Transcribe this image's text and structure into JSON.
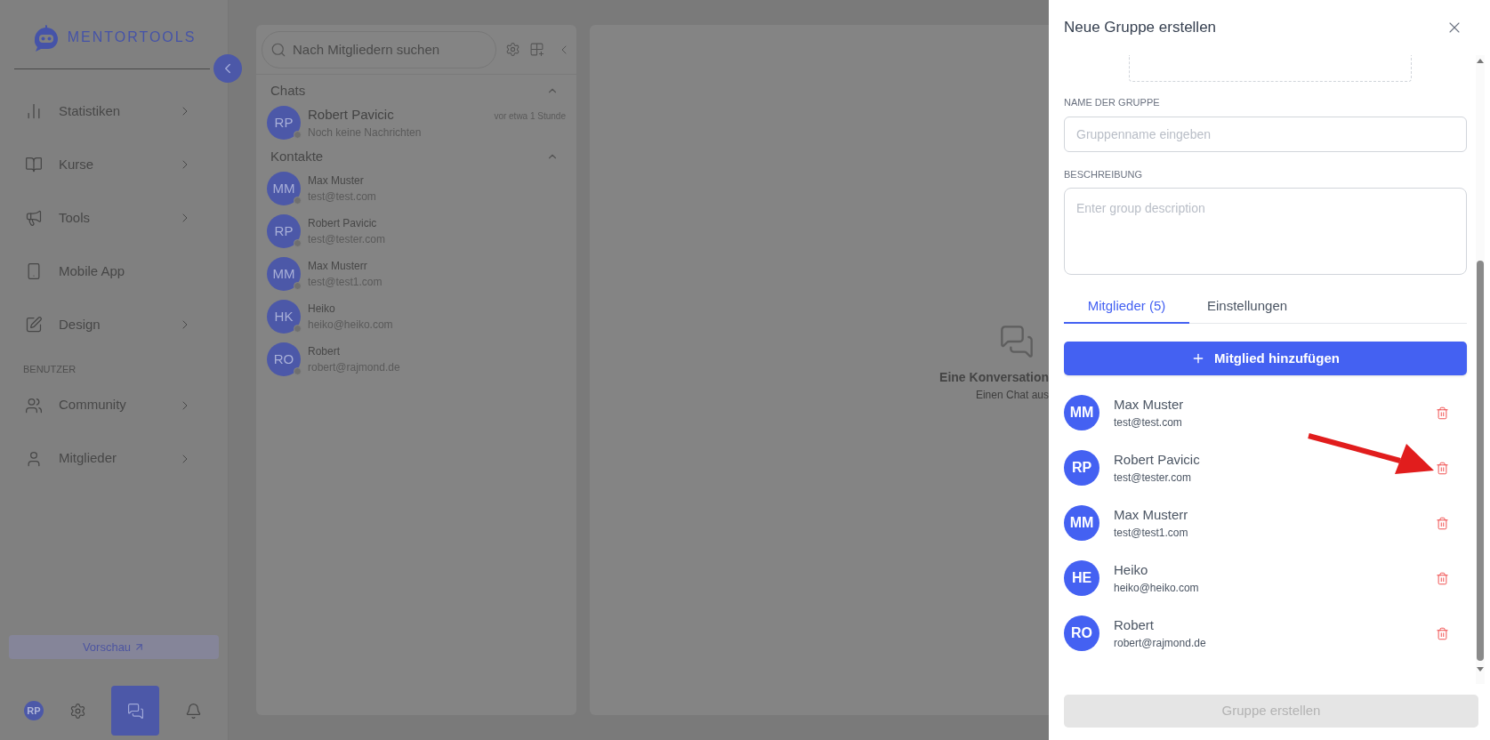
{
  "sidebar": {
    "logo_text": "MENTORTOOLS",
    "nav_items": [
      {
        "kind": "stats",
        "label": "Statistiken",
        "has_submenu": true
      },
      {
        "kind": "book",
        "label": "Kurse",
        "has_submenu": true
      },
      {
        "kind": "megaphone",
        "label": "Tools",
        "has_submenu": true
      },
      {
        "kind": "phone",
        "label": "Mobile App",
        "has_submenu": false
      },
      {
        "kind": "pen",
        "label": "Design",
        "has_submenu": true
      }
    ],
    "section_label": "BENUTZER",
    "user_items": [
      {
        "kind": "group",
        "label": "Community",
        "has_submenu": true
      },
      {
        "kind": "person",
        "label": "Mitglieder",
        "has_submenu": true
      }
    ],
    "preview_button": "Vorschau",
    "bottom_bar": [
      {
        "kind": "avatar",
        "initials": "RP",
        "selected": false
      },
      {
        "kind": "settings",
        "selected": false
      },
      {
        "kind": "chat",
        "selected": true
      },
      {
        "kind": "bell",
        "selected": false
      }
    ]
  },
  "chat_panel": {
    "search": {
      "placeholder": "Nach Mitgliedern suchen"
    },
    "chats_header": "Chats",
    "chats": [
      {
        "initials": "RP",
        "name": "Robert Pavicic",
        "preview": "Noch keine Nachrichten",
        "time": "vor etwa 1 Stunde"
      }
    ],
    "contacts_header": "Kontakte",
    "contacts": [
      {
        "initials": "MM",
        "name": "Max Muster",
        "email": "test@test.com"
      },
      {
        "initials": "RP",
        "name": "Robert Pavicic",
        "email": "test@tester.com"
      },
      {
        "initials": "MM",
        "name": "Max Musterr",
        "email": "test@test1.com"
      },
      {
        "initials": "HK",
        "name": "Heiko",
        "email": "heiko@heiko.com"
      },
      {
        "initials": "RO",
        "name": "Robert",
        "email": "robert@rajmond.de"
      }
    ]
  },
  "conversation": {
    "empty_title": "Eine Konversation",
    "empty_subtitle": "Einen Chat aus"
  },
  "drawer": {
    "title": "Neue Gruppe erstellen",
    "name_label": "NAME DER GRUPPE",
    "name_field": {
      "placeholder": "Gruppenname eingeben"
    },
    "description_label": "BESCHREIBUNG",
    "description_field": {
      "placeholder": "Enter group description"
    },
    "tabs": [
      {
        "label": "Mitglieder (5)",
        "selected": true
      },
      {
        "label": "Einstellungen",
        "selected": false
      }
    ],
    "add_member_button": "Mitglied hinzufügen",
    "members": [
      {
        "initials": "MM",
        "name": "Max Muster",
        "email": "test@test.com"
      },
      {
        "initials": "RP",
        "name": "Robert Pavicic",
        "email": "test@tester.com"
      },
      {
        "initials": "MM",
        "name": "Max Musterr",
        "email": "test@test1.com"
      },
      {
        "initials": "HE",
        "name": "Heiko",
        "email": "heiko@heiko.com"
      },
      {
        "initials": "RO",
        "name": "Robert",
        "email": "robert@rajmond.de"
      }
    ],
    "create_button": {
      "label": "Gruppe erstellen",
      "disabled": true
    }
  }
}
